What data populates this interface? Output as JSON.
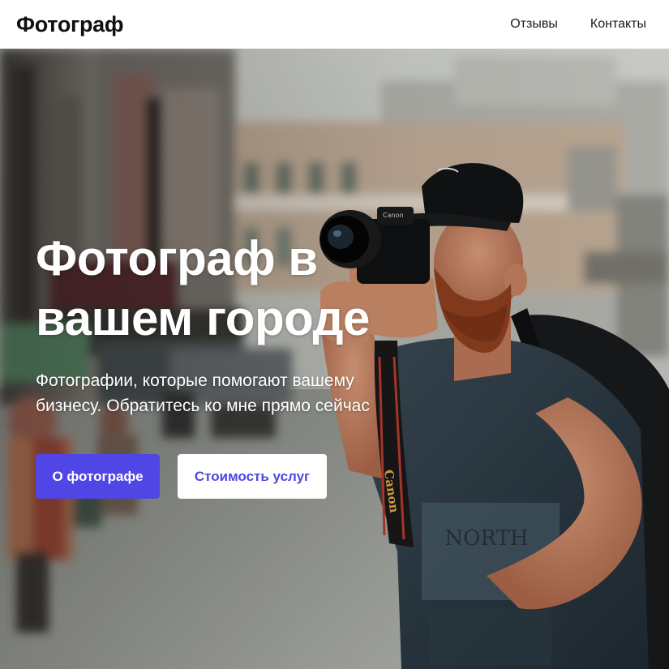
{
  "header": {
    "logo": "Фотограф",
    "nav": [
      {
        "label": "Отзывы"
      },
      {
        "label": "Контакты"
      }
    ]
  },
  "hero": {
    "title_line1": "Фотограф в",
    "title_line2": "вашем городе",
    "subtitle_line1": "Фотографии, которые помогают вашему",
    "subtitle_line2": "бизнесу. Обратитесь ко мне прямо сейчас",
    "primary_button": "О фотографе",
    "secondary_button": "Стоимость услуг",
    "camera_strap_text": "Canon",
    "image": "street-photographer-with-camera"
  },
  "colors": {
    "accent": "#4f46e5",
    "header_bg": "#ffffff",
    "hero_text": "#ffffff"
  }
}
